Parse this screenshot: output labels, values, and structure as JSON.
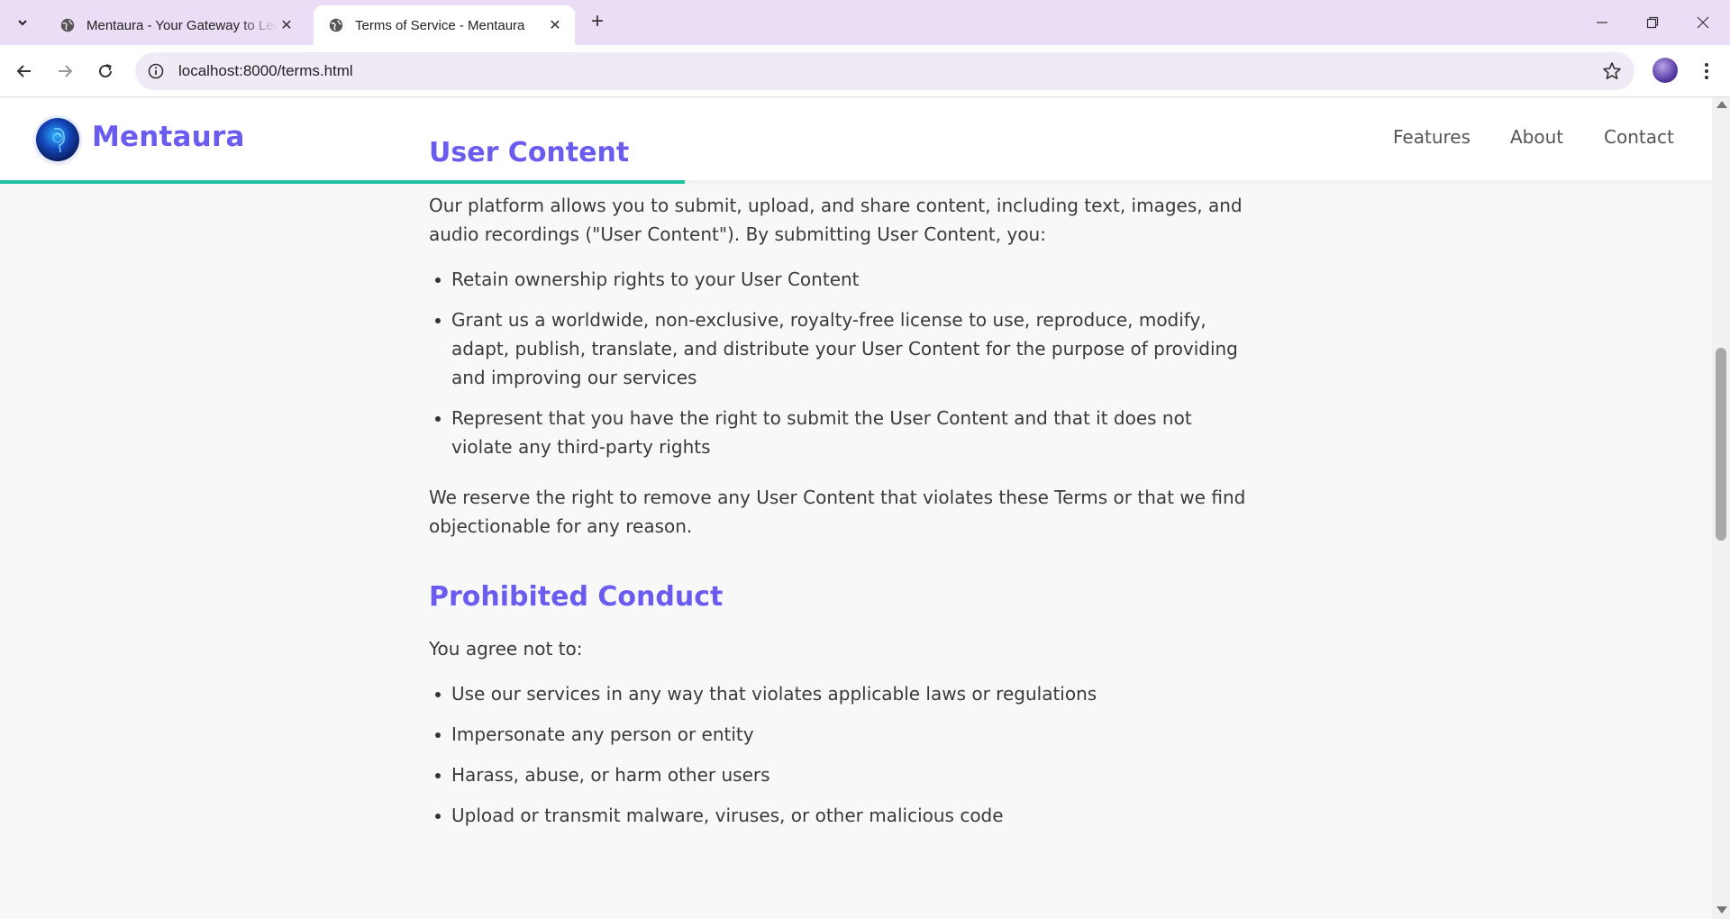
{
  "browser": {
    "tabs": [
      {
        "title": "Mentaura - Your Gateway to Learning"
      },
      {
        "title": "Terms of Service - Mentaura"
      }
    ],
    "url": "localhost:8000/terms.html"
  },
  "site": {
    "brand": "Mentaura",
    "nav": [
      "Features",
      "About",
      "Contact"
    ],
    "scroll_progress_fraction": 0.4
  },
  "sections": [
    {
      "heading": "User Content",
      "intro": "Our platform allows you to submit, upload, and share content, including text, images, and audio recordings (\"User Content\"). By submitting User Content, you:",
      "items": [
        "Retain ownership rights to your User Content",
        "Grant us a worldwide, non-exclusive, royalty-free license to use, reproduce, modify, adapt, publish, translate, and distribute your User Content for the purpose of providing and improving our services",
        "Represent that you have the right to submit the User Content and that it does not violate any third-party rights"
      ],
      "outro": "We reserve the right to remove any User Content that violates these Terms or that we find objectionable for any reason."
    },
    {
      "heading": "Prohibited Conduct",
      "intro": "You agree not to:",
      "items": [
        "Use our services in any way that violates applicable laws or regulations",
        "Impersonate any person or entity",
        "Harass, abuse, or harm other users",
        "Upload or transmit malware, viruses, or other malicious code"
      ]
    }
  ]
}
